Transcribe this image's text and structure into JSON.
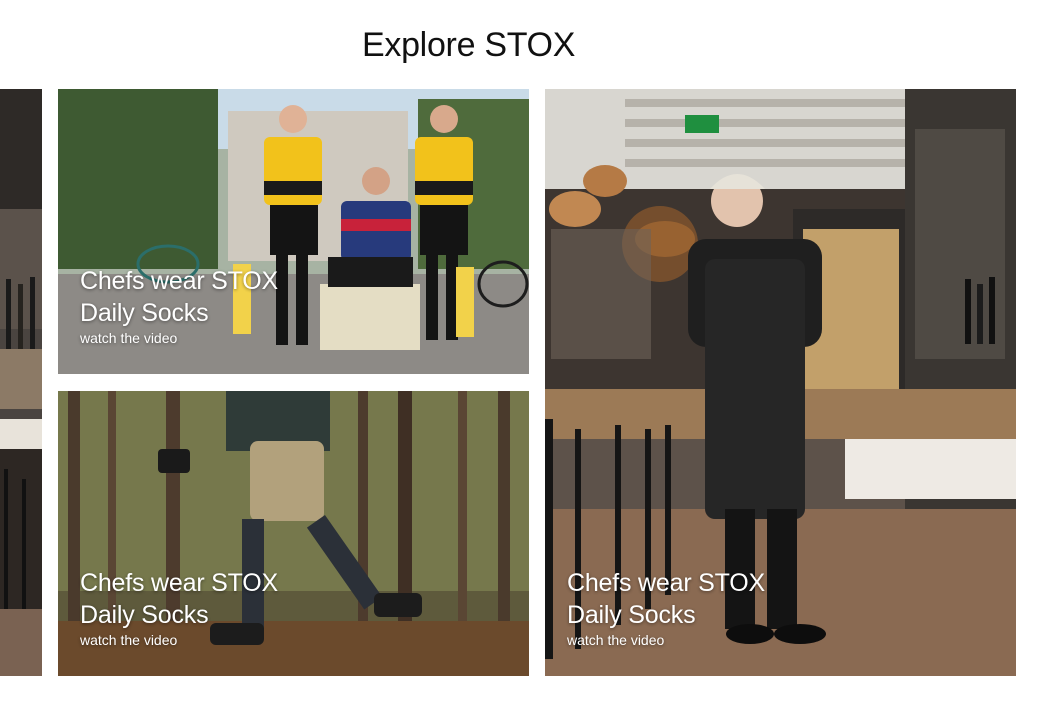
{
  "heading": "Explore STOX",
  "tiles": [
    {
      "title": "Chefs wear STOX Daily Socks",
      "link": "watch the video",
      "scene": "cyclists"
    },
    {
      "title": "Chefs wear STOX Daily Socks",
      "link": "watch the video",
      "scene": "forest-hiker"
    },
    {
      "title": "Chefs wear STOX Daily Socks",
      "link": "watch the video",
      "scene": "chef-restaurant"
    },
    {
      "scene": "restaurant-interior-left"
    }
  ],
  "colors": {
    "text": "#111111",
    "caption": "#ffffff",
    "jersey_yellow": "#f2c21b"
  }
}
